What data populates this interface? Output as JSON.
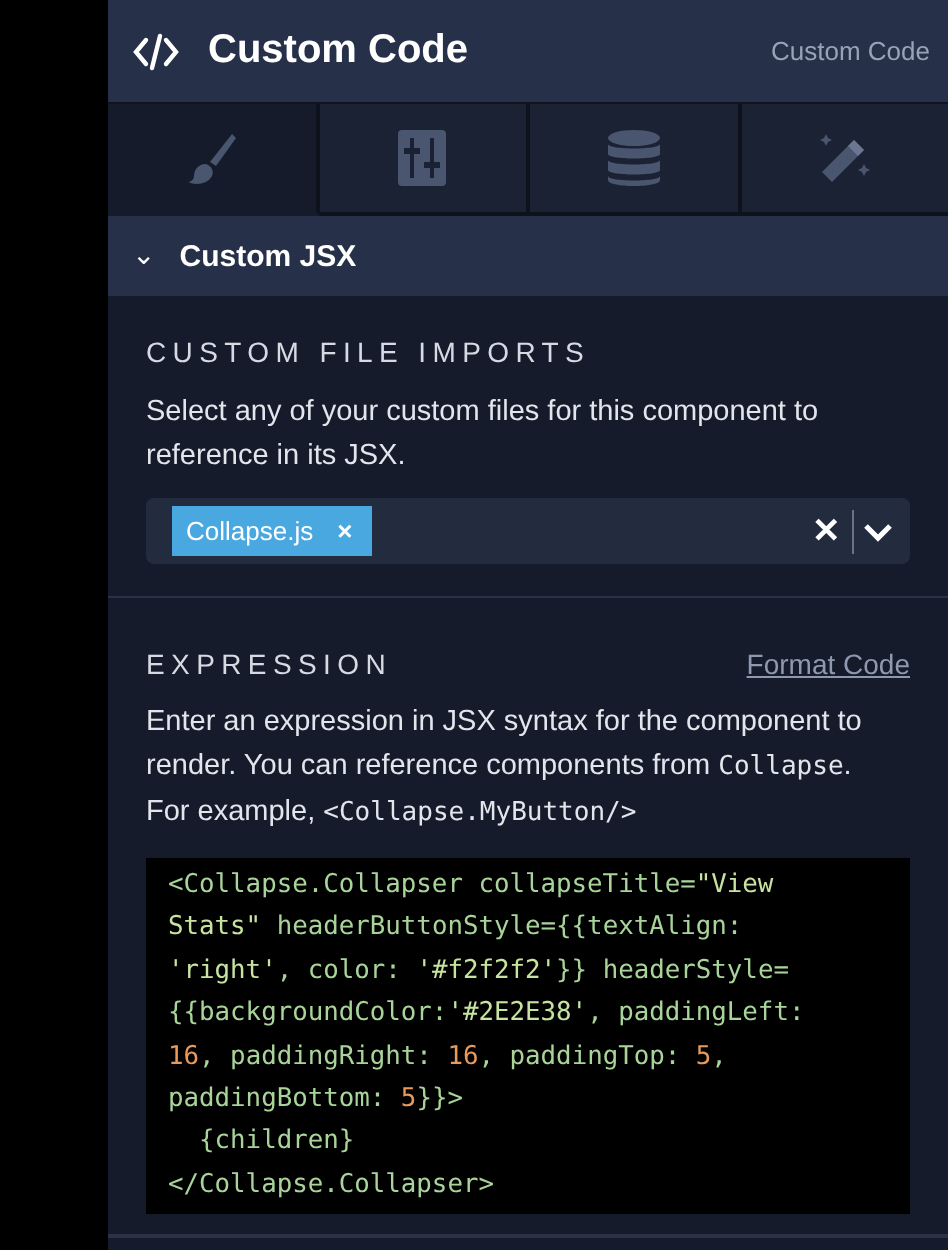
{
  "header": {
    "title": "Custom Code",
    "subtitle": "Custom Code"
  },
  "tabs": [
    {
      "kind": "brush",
      "selected": true
    },
    {
      "kind": "sliders",
      "selected": false
    },
    {
      "kind": "database",
      "selected": false
    },
    {
      "kind": "wand",
      "selected": false
    }
  ],
  "section": {
    "title": "Custom JSX",
    "expanded": true,
    "chevron": "⌄"
  },
  "imports": {
    "label": "CUSTOM FILE IMPORTS",
    "description": "Select any of your custom files for this component to reference in its JSX.",
    "tags": [
      {
        "label": "Collapse.js",
        "remove": "×"
      }
    ],
    "clear": "✕"
  },
  "expression": {
    "label": "EXPRESSION",
    "link": "Format Code",
    "description": [
      {
        "kind": "text",
        "text": "Enter an expression in JSX syntax for the component to render. You can reference components from "
      },
      {
        "kind": "code",
        "text": "Collapse"
      },
      {
        "kind": "text",
        "text": ". For example, "
      },
      {
        "kind": "code",
        "text": "<Collapse.MyButton/>"
      }
    ],
    "code": [
      [
        {
          "kind": "text",
          "text": "<Collapse.Collapser collapseTitle="
        },
        {
          "kind": "string",
          "text": "\"View"
        }
      ],
      [
        {
          "kind": "string",
          "text": "Stats\""
        },
        {
          "kind": "text",
          "text": " headerButtonStyle={{textAlign:"
        }
      ],
      [
        {
          "kind": "string",
          "text": "'right'"
        },
        {
          "kind": "text",
          "text": ", color: "
        },
        {
          "kind": "string",
          "text": "'#f2f2f2'"
        },
        {
          "kind": "text",
          "text": "}} headerStyle="
        }
      ],
      [
        {
          "kind": "text",
          "text": "{{backgroundColor:"
        },
        {
          "kind": "string",
          "text": "'#2E2E38'"
        },
        {
          "kind": "text",
          "text": ", paddingLeft:"
        }
      ],
      [
        {
          "kind": "number",
          "text": "16"
        },
        {
          "kind": "text",
          "text": ", paddingRight: "
        },
        {
          "kind": "number",
          "text": "16"
        },
        {
          "kind": "text",
          "text": ", paddingTop: "
        },
        {
          "kind": "number",
          "text": "5"
        },
        {
          "kind": "text",
          "text": ","
        }
      ],
      [
        {
          "kind": "text",
          "text": "paddingBottom: "
        },
        {
          "kind": "number",
          "text": "5"
        },
        {
          "kind": "text",
          "text": "}}>"
        }
      ],
      [
        {
          "kind": "text",
          "text": "  {children}"
        }
      ],
      [
        {
          "kind": "text",
          "text": "</Collapse.Collapser>"
        }
      ]
    ]
  }
}
